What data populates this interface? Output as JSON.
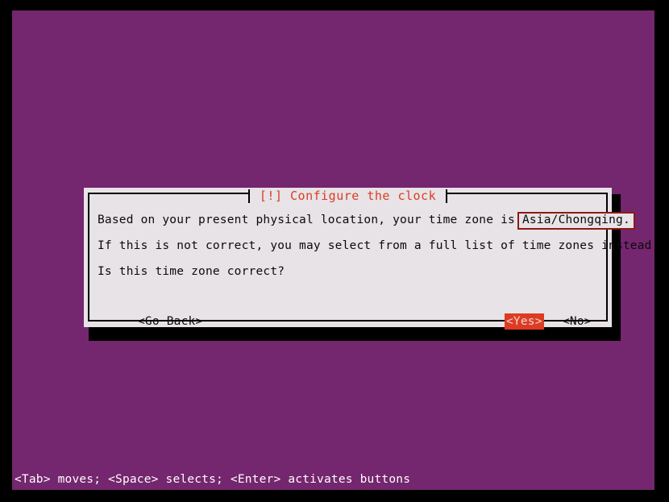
{
  "screen": {
    "background_color": "#74266e",
    "frame_color": "#000000"
  },
  "dialog": {
    "title": "[!] Configure the clock",
    "title_color": "#dd3b23",
    "background_color": "#e7e3e7",
    "border_color": "#000000",
    "shadow_color": "#000000",
    "lines": {
      "line1_prefix": "Based on your present physical location, your time zone is",
      "timezone_value": "Asia/Chongqing.",
      "timezone_box_color": "#8e1a14",
      "line2": "If this is not correct, you may select from a full list of time zones instead.",
      "line3": "Is this time zone correct?"
    },
    "buttons": {
      "go_back": "<Go Back>",
      "yes": "<Yes>",
      "no": "<No>",
      "selected": "<Yes>",
      "selected_background": "#dd3b23",
      "selected_text_color": "#f2d7d2"
    }
  },
  "statusbar": {
    "hint": "<Tab> moves; <Space> selects; <Enter> activates buttons",
    "text_color": "#ffffff"
  }
}
